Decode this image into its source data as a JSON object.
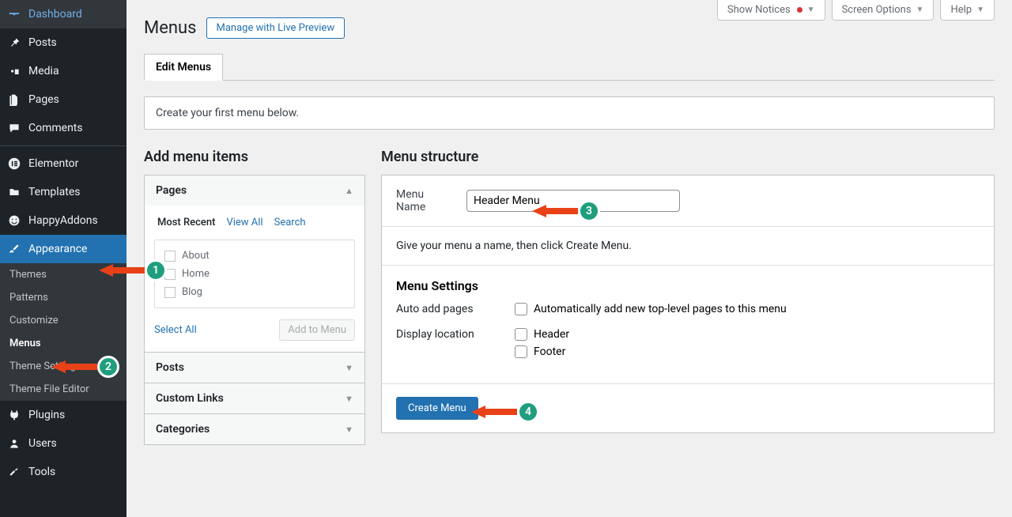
{
  "sidebar": {
    "items": [
      {
        "label": "Dashboard"
      },
      {
        "label": "Posts"
      },
      {
        "label": "Media"
      },
      {
        "label": "Pages"
      },
      {
        "label": "Comments"
      },
      {
        "label": "Elementor"
      },
      {
        "label": "Templates"
      },
      {
        "label": "HappyAddons"
      },
      {
        "label": "Appearance"
      },
      {
        "label": "Plugins"
      },
      {
        "label": "Users"
      },
      {
        "label": "Tools"
      }
    ],
    "submenu": [
      {
        "label": "Themes"
      },
      {
        "label": "Patterns"
      },
      {
        "label": "Customize"
      },
      {
        "label": "Menus"
      },
      {
        "label": "Theme Settings"
      },
      {
        "label": "Theme File Editor"
      }
    ]
  },
  "topbar": {
    "show_notices": "Show Notices",
    "screen_options": "Screen Options",
    "help": "Help"
  },
  "page": {
    "title": "Menus",
    "live_preview": "Manage with Live Preview",
    "tab": "Edit Menus",
    "notice": "Create your first menu below."
  },
  "left_panel": {
    "heading": "Add menu items",
    "pages": {
      "title": "Pages",
      "tabs": {
        "recent": "Most Recent",
        "all": "View All",
        "search": "Search"
      },
      "items": [
        "About",
        "Home",
        "Blog"
      ],
      "select_all": "Select All",
      "add_btn": "Add to Menu"
    },
    "posts": "Posts",
    "custom_links": "Custom Links",
    "categories": "Categories"
  },
  "right_panel": {
    "heading": "Menu structure",
    "menu_name_label": "Menu Name",
    "menu_name_value": "Header Menu",
    "hint": "Give your menu a name, then click Create Menu.",
    "settings_head": "Menu Settings",
    "auto_add_label": "Auto add pages",
    "auto_add_opt": "Automatically add new top-level pages to this menu",
    "display_loc_label": "Display location",
    "loc_header": "Header",
    "loc_footer": "Footer",
    "create_btn": "Create Menu"
  },
  "annotations": [
    "1",
    "2",
    "3",
    "4"
  ]
}
